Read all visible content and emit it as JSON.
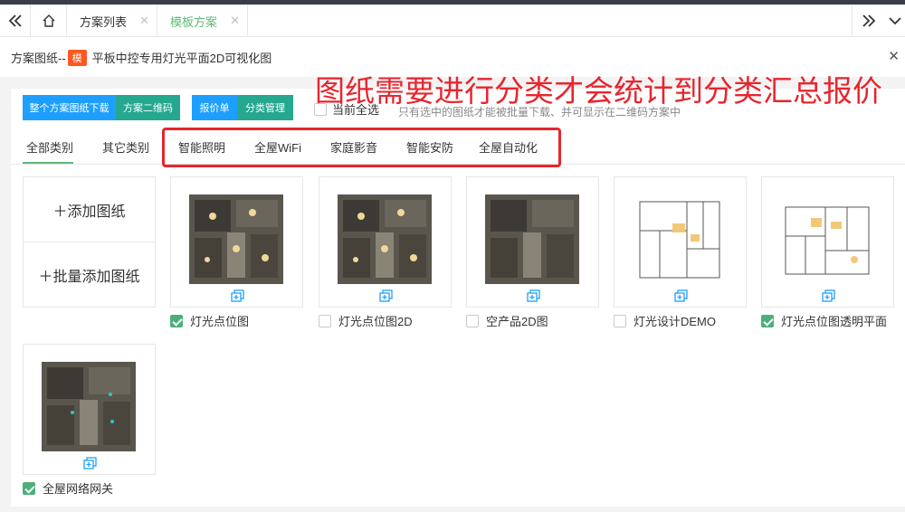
{
  "tabs": [
    {
      "label": "方案列表",
      "active": false
    },
    {
      "label": "模板方案",
      "active": true
    }
  ],
  "header": {
    "prefix": "方案图纸--",
    "badge": "模",
    "title": "平板中控专用灯光平面2D可视化图"
  },
  "annotation": "图纸需要进行分类才会统计到分类汇总报价",
  "toolbar": {
    "download_all": "整个方案图纸下载",
    "qr_code": "方案二维码",
    "quote": "报价单",
    "category_manage": "分类管理",
    "select_all": "当前全选",
    "hint": "只有选中的图纸才能被批量下载、并可显示在二维码方案中"
  },
  "categories": [
    "全部类别",
    "其它类别",
    "智能照明",
    "全屋WiFi",
    "家庭影音",
    "智能安防",
    "全屋自动化"
  ],
  "add": {
    "add_drawing": "＋添加图纸",
    "batch_add": "＋批量添加图纸"
  },
  "drawings": [
    {
      "label": "灯光点位图",
      "checked": true,
      "thumb": "dark"
    },
    {
      "label": "灯光点位图2D",
      "checked": false,
      "thumb": "dark"
    },
    {
      "label": "空产品2D图",
      "checked": false,
      "thumb": "dark"
    },
    {
      "label": "灯光设计DEMO",
      "checked": false,
      "thumb": "light"
    },
    {
      "label": "灯光点位图透明平面",
      "checked": true,
      "thumb": "light"
    },
    {
      "label": "全屋网络网关",
      "checked": true,
      "thumb": "dark"
    }
  ],
  "colors": {
    "blue_button": "#1e9fff",
    "teal_button": "#25a88f",
    "accent_green": "#5fb878",
    "annotation_red": "#e8252d",
    "badge_orange": "#ff5722"
  }
}
